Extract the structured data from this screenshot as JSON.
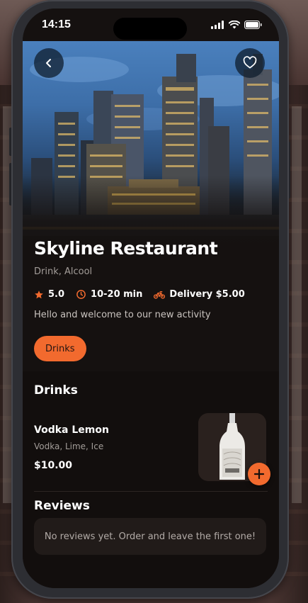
{
  "status_bar": {
    "time": "14:15"
  },
  "restaurant": {
    "name": "Skyline Restaurant",
    "categories": "Drink, Alcool",
    "rating": "5.0",
    "delivery_time": "10-20 min",
    "delivery_fee": "Delivery $5.00",
    "welcome_message": "Hello and welcome to our new activity"
  },
  "filters": {
    "active_chip": "Drinks"
  },
  "menu_section": {
    "title": "Drinks",
    "items": [
      {
        "name": "Vodka Lemon",
        "ingredients": "Vodka, Lime, Ice",
        "price": "$10.00",
        "image_icon": "vodka-bottle-icon"
      }
    ]
  },
  "reviews_section": {
    "title": "Reviews",
    "empty_message": "No reviews yet. Order and leave the first one!"
  },
  "colors": {
    "accent": "#f26a2e",
    "background": "#151110",
    "card": "#211b19"
  }
}
